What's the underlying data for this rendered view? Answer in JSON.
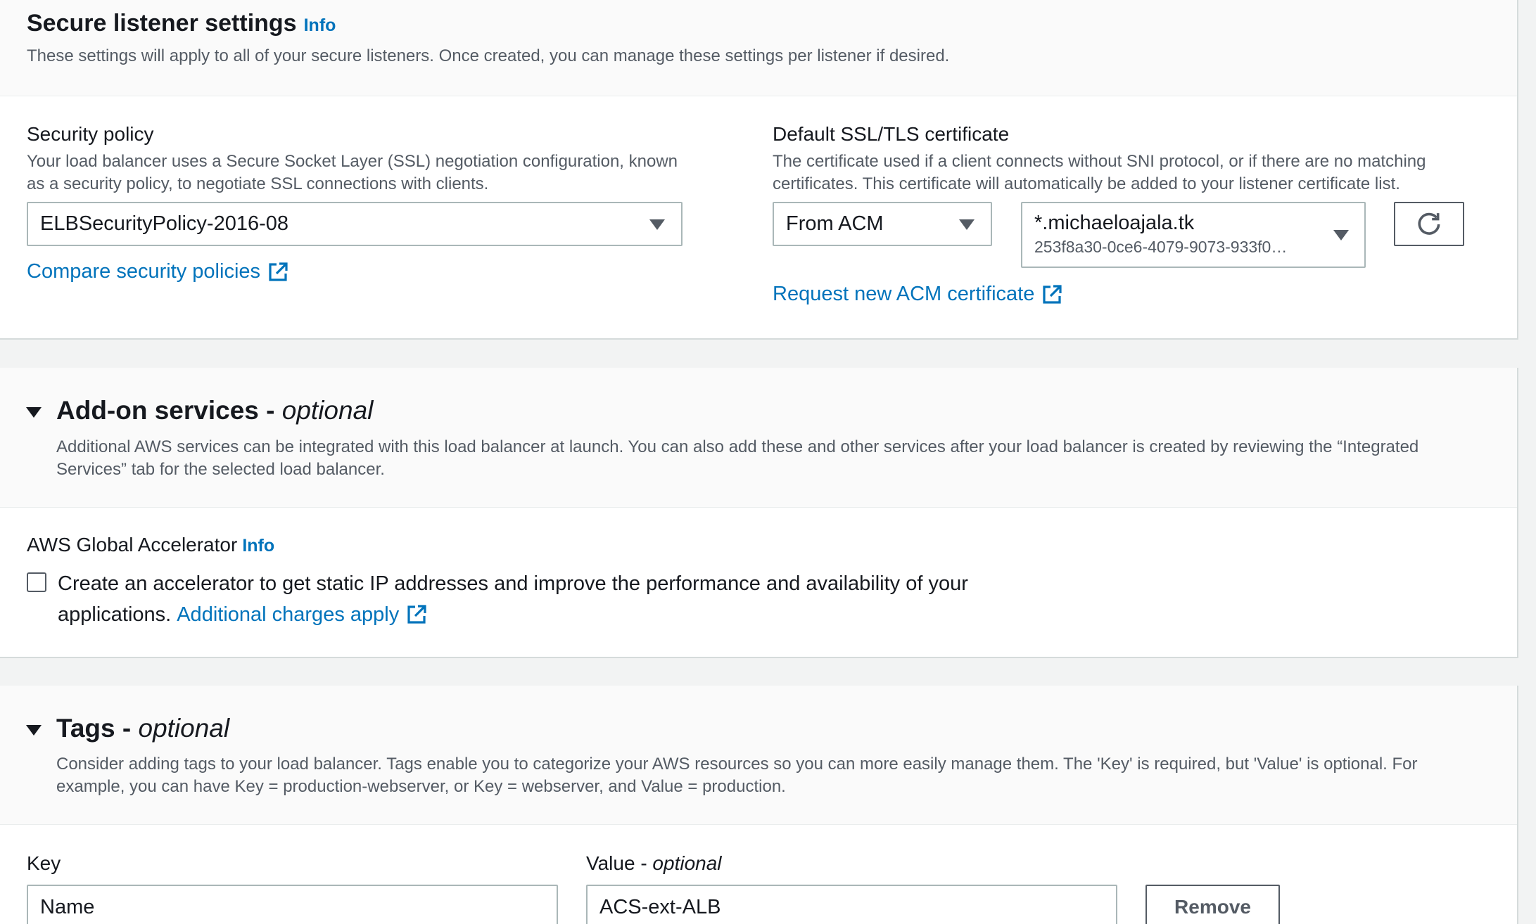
{
  "secure_listener": {
    "title": "Secure listener settings",
    "info": "Info",
    "description": "These settings will apply to all of your secure listeners. Once created, you can manage these settings per listener if desired.",
    "security_policy": {
      "label": "Security policy",
      "description_1": "Your load balancer uses a Secure Socket Layer (SSL) negotiation configuration, known",
      "description_2": "as a security policy, to negotiate SSL connections with clients.",
      "selected": "ELBSecurityPolicy-2016-08",
      "compare_link": "Compare security policies"
    },
    "certificate": {
      "label": "Default SSL/TLS certificate",
      "description_1": "The certificate used if a client connects without SNI protocol, or if there are no matching",
      "description_2": "certificates. This certificate will automatically be added to your listener certificate list.",
      "source_selected": "From ACM",
      "cert_name": "*.michaeloajala.tk",
      "cert_id": "253f8a30-0ce6-4079-9073-933f0…",
      "request_link": "Request new ACM certificate"
    }
  },
  "addon": {
    "title": "Add-on services - ",
    "title_optional": "optional",
    "description_1": "Additional AWS services can be integrated with this load balancer at launch. You can also add these and other services after your load balancer is created by reviewing the “Integrated",
    "description_2": "Services” tab for the selected load balancer.",
    "accelerator_label": "AWS Global Accelerator",
    "accelerator_info": "Info",
    "checkbox_text_1": "Create an accelerator to get static IP addresses and improve the performance and availability of your",
    "checkbox_text_2": "applications.",
    "charges_link": "Additional charges apply",
    "checked": false
  },
  "tags": {
    "title": "Tags - ",
    "title_optional": "optional",
    "description_1": "Consider adding tags to your load balancer. Tags enable you to categorize your AWS resources so you can more easily manage them. The 'Key' is required, but 'Value' is optional. For",
    "description_2": "example, you can have Key = production-webserver, or Key = webserver, and Value = production.",
    "key_label": "Key",
    "value_label": "Value - ",
    "value_label_optional": "optional",
    "key_value": "Name",
    "value_value": "ACS-ext-ALB",
    "remove_button": "Remove"
  },
  "colors": {
    "link": "#0073bb",
    "text": "#16191f",
    "secondary_text": "#545b64",
    "border": "#aab7b8",
    "background": "#f2f3f3"
  },
  "icons": [
    "external-link-icon",
    "refresh-icon",
    "caret-down-icon",
    "expand-triangle-icon"
  ]
}
